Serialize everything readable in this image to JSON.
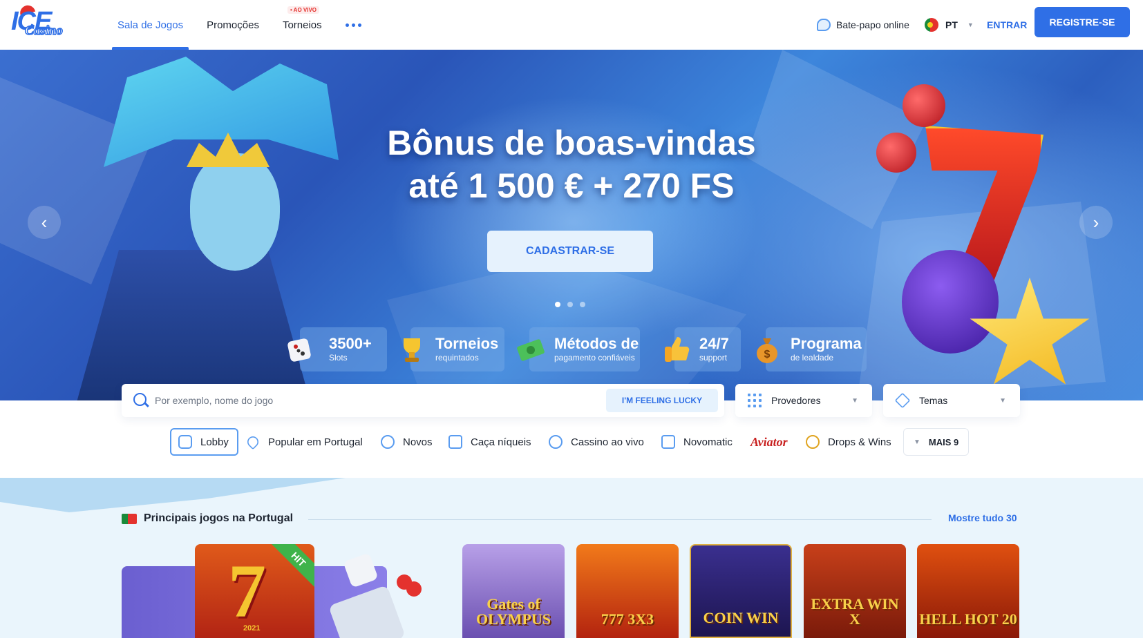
{
  "header": {
    "logo_text": "ICE",
    "logo_sub": "Casino",
    "nav": [
      {
        "label": "Sala de Jogos",
        "active": true
      },
      {
        "label": "Promoções"
      },
      {
        "label": "Torneios",
        "badge": "• AO VIVO"
      }
    ],
    "chat_label": "Bate-papo online",
    "language": "PT",
    "login_label": "ENTRAR",
    "register_label": "REGISTRE-SE"
  },
  "hero": {
    "title_line1": "Bônus de boas-vindas",
    "title_line2": "até 1 500 € + 270 FS",
    "cta_label": "CADASTRAR-SE",
    "slide_count": 3,
    "active_slide": 1,
    "features": [
      {
        "title": "3500+",
        "subtitle": "Slots",
        "icon": "dice-icon"
      },
      {
        "title": "Torneios",
        "subtitle": "requintados",
        "icon": "trophy-icon"
      },
      {
        "title": "Métodos de",
        "subtitle": "pagamento confiáveis",
        "icon": "money-icon"
      },
      {
        "title": "24/7",
        "subtitle": "support",
        "icon": "thumbs-up-icon"
      },
      {
        "title": "Programa",
        "subtitle": "de lealdade",
        "icon": "money-bag-icon"
      }
    ]
  },
  "search": {
    "placeholder": "Por exemplo, nome do jogo",
    "lucky_label": "I'M FEELING LUCKY",
    "providers_label": "Provedores",
    "themes_label": "Temas"
  },
  "categories": [
    {
      "label": "Lobby",
      "icon": "lobby-icon",
      "active": true
    },
    {
      "label": "Popular em Portugal",
      "icon": "heart-icon"
    },
    {
      "label": "Novos",
      "icon": "new-icon"
    },
    {
      "label": "Caça níqueis",
      "icon": "slot-icon"
    },
    {
      "label": "Cassino ao vivo",
      "icon": "live-casino-icon"
    },
    {
      "label": "Novomatic",
      "icon": "novomatic-icon"
    },
    {
      "label": "Aviator",
      "icon": "aviator-logo"
    },
    {
      "label": "Drops & Wins",
      "icon": "drops-wins-icon"
    },
    {
      "label": "MAIS 9",
      "icon": "chevron-down-icon"
    }
  ],
  "games_section": {
    "title": "Principais jogos na Portugal",
    "show_all": "Mostre tudo 30",
    "featured_badge": "HIT",
    "featured_year": "2021",
    "games": [
      {
        "name": "Gates of Olympus",
        "label": "Gates of OLYMPUS"
      },
      {
        "name": "777 3x3",
        "label": "777 3X3"
      },
      {
        "name": "Coin Win",
        "label": "COIN WIN"
      },
      {
        "name": "Extra Win X",
        "label": "EXTRA WIN X"
      },
      {
        "name": "Hell Hot 20",
        "label": "HELL HOT 20"
      }
    ]
  },
  "colors": {
    "accent": "#2f6fe6",
    "hero_bg": "#3b6fd0",
    "games_bg": "#eaf5fc"
  }
}
